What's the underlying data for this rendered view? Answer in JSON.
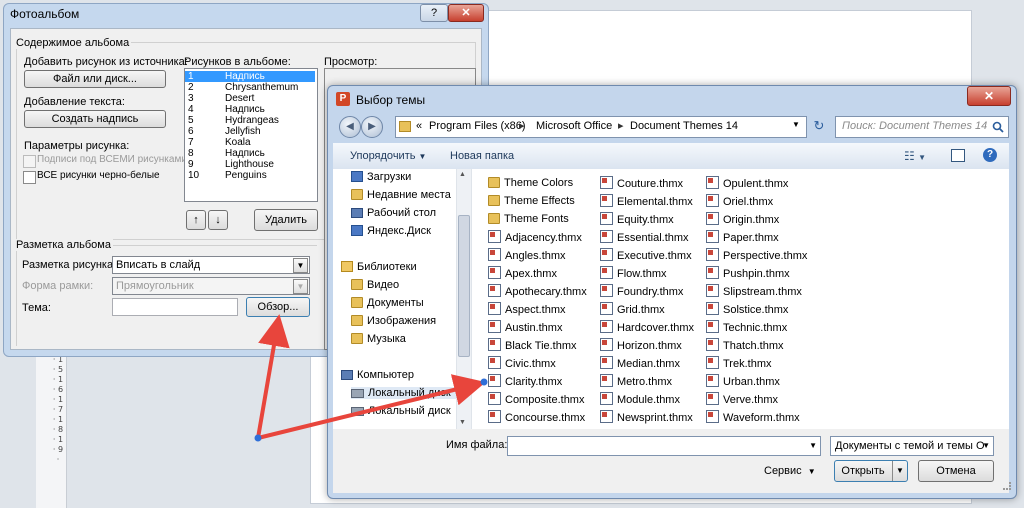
{
  "background": {
    "ruler_text": "· 4 · 1 · 5 · 1 · 6 · 1 · 7 · 1 · 8 · 1 · 9 ·"
  },
  "photo_album": {
    "title": "Фотоальбом",
    "help_label": "?",
    "close_label": "✕",
    "content_group_label": "Содержимое альбома",
    "insert_from_label": "Добавить рисунок из источника:",
    "file_disk_button": "Файл или диск...",
    "add_text_label": "Добавление текста:",
    "new_textbox_button": "Создать надпись",
    "picture_options_label": "Параметры рисунка:",
    "captions_below_label": "Подписи под ВСЕМИ рисунками",
    "all_bw_label": "ВСЕ рисунки черно-белые",
    "pictures_in_album_label": "Рисунков в альбоме:",
    "pictures": [
      {
        "num": "1",
        "name": "Надпись",
        "selected": true
      },
      {
        "num": "2",
        "name": "Chrysanthemum"
      },
      {
        "num": "3",
        "name": "Desert"
      },
      {
        "num": "4",
        "name": "Надпись"
      },
      {
        "num": "5",
        "name": "Hydrangeas"
      },
      {
        "num": "6",
        "name": "Jellyfish"
      },
      {
        "num": "7",
        "name": "Koala"
      },
      {
        "num": "8",
        "name": "Надпись"
      },
      {
        "num": "9",
        "name": "Lighthouse"
      },
      {
        "num": "10",
        "name": "Penguins"
      }
    ],
    "move_up_icon": "↑",
    "move_down_icon": "↓",
    "delete_button": "Удалить",
    "preview_label": "Просмотр:",
    "layout_group_label": "Разметка альбома",
    "picture_layout_label": "Разметка рисунка:",
    "picture_layout_value": "Вписать в слайд",
    "frame_shape_label": "Форма рамки:",
    "frame_shape_value": "Прямоугольник",
    "theme_label": "Тема:",
    "theme_value": "",
    "browse_button": "Обзор..."
  },
  "theme_dialog": {
    "title": "Выбор темы",
    "close_label": "✕",
    "app_icon_letter": "P",
    "back_icon": "◀",
    "forward_icon": "▶",
    "breadcrumb": [
      "«",
      "Program Files (x86)",
      "Microsoft Office",
      "Document Themes 14"
    ],
    "refresh_icon": "↻",
    "search_placeholder": "Поиск: Document Themes 14",
    "organize_label": "Упорядочить",
    "new_folder_label": "Новая папка",
    "nav_items": [
      {
        "label": "Загрузки",
        "icon": "download-folder-icon"
      },
      {
        "label": "Недавние места",
        "icon": "recent-places-icon"
      },
      {
        "label": "Рабочий стол",
        "icon": "desktop-icon"
      },
      {
        "label": "Яндекс.Диск",
        "icon": "yandex-disk-icon"
      },
      {
        "label": "Библиотеки",
        "icon": "libraries-icon"
      },
      {
        "label": "Видео",
        "icon": "video-library-icon"
      },
      {
        "label": "Документы",
        "icon": "documents-library-icon"
      },
      {
        "label": "Изображения",
        "icon": "pictures-library-icon"
      },
      {
        "label": "Музыка",
        "icon": "music-library-icon"
      },
      {
        "label": "Компьютер",
        "icon": "computer-icon"
      },
      {
        "label": "Локальный диск",
        "icon": "local-disk-icon"
      },
      {
        "label": "Локальный диск",
        "icon": "local-disk-icon"
      }
    ],
    "files_col1": [
      "Theme Colors",
      "Theme Effects",
      "Theme Fonts",
      "Adjacency.thmx",
      "Angles.thmx",
      "Apex.thmx",
      "Apothecary.thmx",
      "Aspect.thmx",
      "Austin.thmx",
      "Black Tie.thmx",
      "Civic.thmx",
      "Clarity.thmx",
      "Composite.thmx",
      "Concourse.thmx"
    ],
    "files_col2": [
      "Couture.thmx",
      "Elemental.thmx",
      "Equity.thmx",
      "Essential.thmx",
      "Executive.thmx",
      "Flow.thmx",
      "Foundry.thmx",
      "Grid.thmx",
      "Hardcover.thmx",
      "Horizon.thmx",
      "Median.thmx",
      "Metro.thmx",
      "Module.thmx",
      "Newsprint.thmx"
    ],
    "files_col3": [
      "Opulent.thmx",
      "Oriel.thmx",
      "Origin.thmx",
      "Paper.thmx",
      "Perspective.thmx",
      "Pushpin.thmx",
      "Slipstream.thmx",
      "Solstice.thmx",
      "Technic.thmx",
      "Thatch.thmx",
      "Trek.thmx",
      "Urban.thmx",
      "Verve.thmx",
      "Waveform.thmx"
    ],
    "folder_count": 3,
    "filename_label": "Имя файла:",
    "filename_value": "",
    "filetype_value": "Документы с темой и темы О",
    "tools_label": "Сервис",
    "open_button": "Открыть",
    "cancel_button": "Отмена"
  },
  "colors": {
    "arrow": "#e8453c",
    "selection": "#3399ff",
    "arrow_dot": "#2f6fd8"
  }
}
